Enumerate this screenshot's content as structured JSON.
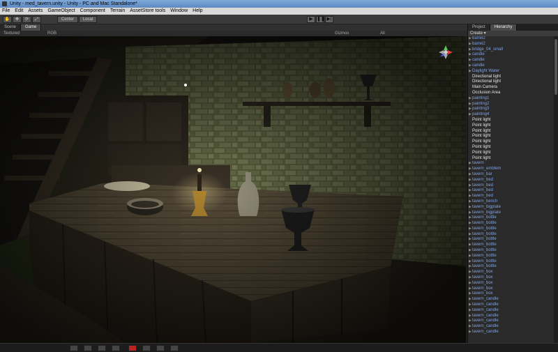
{
  "window": {
    "title": "Unity - med_tavern.unity - Unity - PC and Mac Standalone*"
  },
  "menu": [
    "File",
    "Edit",
    "Assets",
    "GameObject",
    "Component",
    "Terrain",
    "AssetStore tools",
    "Window",
    "Help"
  ],
  "toolbar": {
    "pivot_label": "Center",
    "space_label": "Local",
    "play_icon": "▶",
    "pause_icon": "❚❚",
    "step_icon": "▶|"
  },
  "scene_tabs": [
    {
      "label": "Scene",
      "active": false
    },
    {
      "label": "Game",
      "active": true
    }
  ],
  "scene_subbar": {
    "render_mode": "Textured",
    "rgb_mode": "RGB",
    "gizmos": "Gizmos",
    "search": "All"
  },
  "panel": {
    "tabs": [
      {
        "label": "Project",
        "active": false
      },
      {
        "label": "Hierarchy",
        "active": true
      }
    ],
    "create_label": "Create ▾"
  },
  "hierarchy": [
    {
      "name": "barrel2",
      "prefab": true
    },
    {
      "name": "barrel2",
      "prefab": true
    },
    {
      "name": "bridge_04_small",
      "prefab": true
    },
    {
      "name": "candle",
      "prefab": true
    },
    {
      "name": "candle",
      "prefab": true
    },
    {
      "name": "candle",
      "prefab": true
    },
    {
      "name": "Daylight Water",
      "prefab": true
    },
    {
      "name": "Directional light",
      "prefab": false
    },
    {
      "name": "Directional light",
      "prefab": false
    },
    {
      "name": "Main Camera",
      "prefab": false
    },
    {
      "name": "Occlusion Area",
      "prefab": false
    },
    {
      "name": "painting1",
      "prefab": true
    },
    {
      "name": "painting2",
      "prefab": true
    },
    {
      "name": "painting3",
      "prefab": true
    },
    {
      "name": "painting4",
      "prefab": true
    },
    {
      "name": "Point light",
      "prefab": false
    },
    {
      "name": "Point light",
      "prefab": false
    },
    {
      "name": "Point light",
      "prefab": false
    },
    {
      "name": "Point light",
      "prefab": false
    },
    {
      "name": "Point light",
      "prefab": false
    },
    {
      "name": "Point light",
      "prefab": false
    },
    {
      "name": "Point light",
      "prefab": false
    },
    {
      "name": "Point light",
      "prefab": false
    },
    {
      "name": "tavern",
      "prefab": true
    },
    {
      "name": "tavern_emblem",
      "prefab": true
    },
    {
      "name": "tavern_bar",
      "prefab": true
    },
    {
      "name": "tavern_bed",
      "prefab": true
    },
    {
      "name": "tavern_bed",
      "prefab": true
    },
    {
      "name": "tavern_bed",
      "prefab": true
    },
    {
      "name": "tavern_bed",
      "prefab": true
    },
    {
      "name": "tavern_bench",
      "prefab": true
    },
    {
      "name": "tavern_bigplate",
      "prefab": true
    },
    {
      "name": "tavern_bigplate",
      "prefab": true
    },
    {
      "name": "tavern_bottle",
      "prefab": true
    },
    {
      "name": "tavern_bottle",
      "prefab": true
    },
    {
      "name": "tavern_bottle",
      "prefab": true
    },
    {
      "name": "tavern_bottle",
      "prefab": true
    },
    {
      "name": "tavern_bottle",
      "prefab": true
    },
    {
      "name": "tavern_bottle",
      "prefab": true
    },
    {
      "name": "tavern_bottle",
      "prefab": true
    },
    {
      "name": "tavern_bottle",
      "prefab": true
    },
    {
      "name": "tavern_bottle",
      "prefab": true
    },
    {
      "name": "tavern_bottle",
      "prefab": true
    },
    {
      "name": "tavern_box",
      "prefab": true
    },
    {
      "name": "tavern_box",
      "prefab": true
    },
    {
      "name": "tavern_box",
      "prefab": true
    },
    {
      "name": "tavern_box",
      "prefab": true
    },
    {
      "name": "tavern_box",
      "prefab": true
    },
    {
      "name": "tavern_candle",
      "prefab": true
    },
    {
      "name": "tavern_candle",
      "prefab": true
    },
    {
      "name": "tavern_candle",
      "prefab": true
    },
    {
      "name": "tavern_candle",
      "prefab": true
    },
    {
      "name": "tavern_candle",
      "prefab": true
    },
    {
      "name": "tavern_candle",
      "prefab": true
    },
    {
      "name": "tavern_candle",
      "prefab": true
    }
  ],
  "colors": {
    "prefab_text": "#7fa2e8",
    "plain_text": "#e6e6e6",
    "stone_wall": "#6a7048",
    "wood": "#3b3226",
    "table_top": "#4e4536"
  }
}
